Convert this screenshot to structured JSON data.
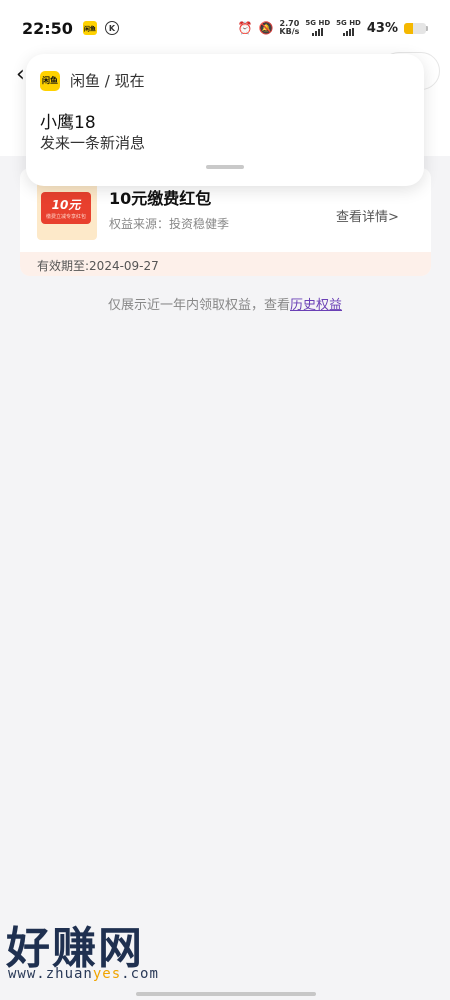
{
  "status_bar": {
    "time": "22:50",
    "app_icon_text": "闲鱼",
    "k_glyph": "K",
    "net_speed_value": "2.70",
    "net_speed_unit": "KB/s",
    "sim1": "5G HD",
    "sim2": "5G HD",
    "battery_percent": "43%",
    "battery_level": 0.43,
    "battery_color": "#f5b800"
  },
  "header": {
    "back_icon": "‹"
  },
  "notification": {
    "app_name": "闲鱼 / 现在",
    "app_icon_text": "闲鱼",
    "title": "小鹰18",
    "body": "发来一条新消息"
  },
  "coupon": {
    "thumb_value": "10元",
    "thumb_caption": "缴费立减专享红包",
    "title": "10元缴费红包",
    "source": "权益来源：投资稳健季",
    "detail_label": "查看详情>",
    "expiry": "有效期至:2024-09-27"
  },
  "footer": {
    "note": "仅展示近一年内领取权益，查看",
    "link": "历史权益"
  },
  "watermark": {
    "brand": "好赚网",
    "url_prefix": "www.zhuan",
    "url_highlight": "yes",
    "url_suffix": ".com"
  },
  "colors": {
    "accent_yellow": "#ffd200",
    "coupon_red": "#e8402e",
    "link_purple": "#6a3fb5",
    "expiry_bg": "#fdf0ea"
  }
}
